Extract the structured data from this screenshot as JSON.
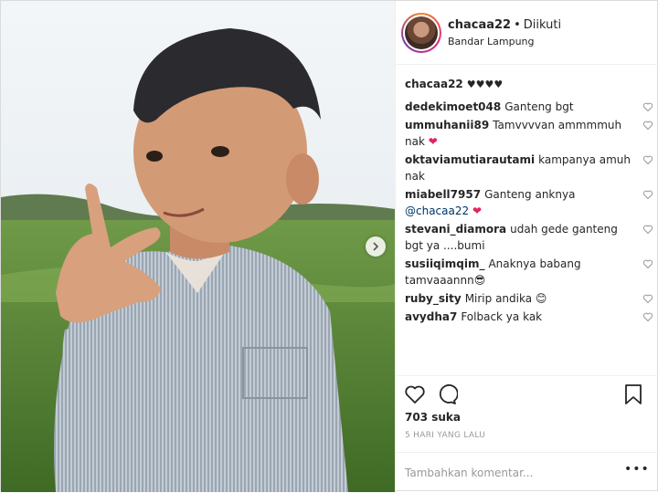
{
  "post": {
    "username": "chacaa22",
    "separator": "•",
    "follow_status": "Diikuti",
    "location": "Bandar Lampung"
  },
  "caption": {
    "username": "chacaa22",
    "text": "♥♥♥♥"
  },
  "comments": [
    {
      "user": "dedekimoet048",
      "text": "Ganteng bgt"
    },
    {
      "user": "ummuhanii89",
      "text": "Tamvvvvan ammmmuh nak",
      "emoji": "❤"
    },
    {
      "user": "oktaviamutiarautami",
      "text": "kampanya amuh nak"
    },
    {
      "user": "miabell7957",
      "text": "Ganteng anknya",
      "mention": "@chacaa22",
      "emoji": "❤"
    },
    {
      "user": "stevani_diamora",
      "text": "udah gede ganteng bgt ya ....bumi"
    },
    {
      "user": "susiiqimqim_",
      "text": "Anaknya babang tamvaaannn",
      "emoji": "😎"
    },
    {
      "user": "ruby_sity",
      "text": "Mirip andika",
      "emoji": "😊"
    },
    {
      "user": "avydha7",
      "text": "Folback ya kak"
    }
  ],
  "likes": "703 suka",
  "timestamp": "5 HARI YANG LALU",
  "add_comment": {
    "placeholder": "Tambahkan komentar..."
  },
  "more_label": "•••",
  "icons": {
    "like": "heart-outline-icon",
    "comment": "speech-bubble-icon",
    "save": "bookmark-icon",
    "next": "chevron-right-icon"
  },
  "colors": {
    "border": "#dbdbdb",
    "mention": "#003569",
    "heart": "#e0245e",
    "muted": "#999999"
  }
}
